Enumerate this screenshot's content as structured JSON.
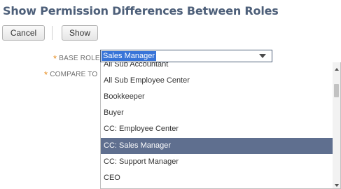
{
  "page": {
    "title": "Show Permission Differences Between Roles"
  },
  "toolbar": {
    "cancel_label": "Cancel",
    "show_label": "Show"
  },
  "form": {
    "base_role_label": "BASE ROLE",
    "compare_to_label": "COMPARE TO",
    "required_marker": "*",
    "base_role_value": "Sales Manager"
  },
  "dropdown": {
    "options": [
      "All Sub Accountant",
      "All Sub Employee Center",
      "Bookkeeper",
      "Buyer",
      "CC: Employee Center",
      "CC: Sales Manager",
      "CC: Support Manager",
      "CEO"
    ],
    "selected_index": 5
  },
  "icons": {
    "select_arrow": "chevron-down-icon",
    "scroll_up": "scroll-up-icon",
    "scroll_down": "scroll-down-icon"
  }
}
